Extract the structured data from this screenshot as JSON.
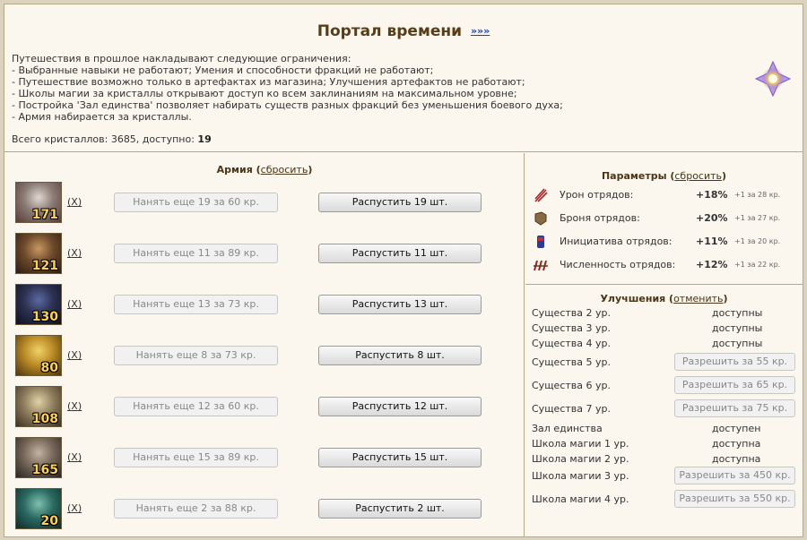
{
  "header": {
    "title": "Портал времени",
    "title_link": "»»»",
    "restrictions": [
      "Путешествия в прошлое накладывают следующие ограничения:",
      "- Выбранные навыки не работают; Умения и способности фракций не работают;",
      "- Путешествие возможно только в артефактах из магазина; Улучшения артефактов не работают;",
      "- Школы магии за кристаллы открывают доступ ко всем заклинаниям на максимальном уровне;",
      "- Постройка 'Зал единства' позволяет набирать существ разных фракций без уменьшения боевого духа;",
      "- Армия набирается за кристаллы."
    ],
    "crystals_label": "Всего кристаллов: 3685, доступно: ",
    "crystals_available": "19",
    "icon": "portal-crystal-icon"
  },
  "army": {
    "title": "Армия",
    "reset_label": "сбросить",
    "units": [
      {
        "count": "171",
        "x_label": "X",
        "hire_label": "Нанять еще 19 за 60 кр.",
        "dismiss_label": "Распустить 19 шт.",
        "portrait": "monk-portrait",
        "colors": [
          "#8a7c74",
          "#e0d6d2",
          "#5b3b3a"
        ]
      },
      {
        "count": "121",
        "x_label": "X",
        "hire_label": "Нанять еще 11 за 89 кр.",
        "dismiss_label": "Распустить 11 шт.",
        "portrait": "centaur-portrait",
        "colors": [
          "#6d4a2b",
          "#c89761",
          "#2d1c10"
        ]
      },
      {
        "count": "130",
        "x_label": "X",
        "hire_label": "Нанять еще 13 за 73 кр.",
        "dismiss_label": "Распустить 13 шт.",
        "portrait": "dark-hood-portrait",
        "colors": [
          "#2d3152",
          "#5a6aa0",
          "#0f1020"
        ]
      },
      {
        "count": "80",
        "x_label": "X",
        "hire_label": "Нанять еще 8 за 73 кр.",
        "dismiss_label": "Распустить 8 шт.",
        "portrait": "golden-helm-portrait",
        "colors": [
          "#b98a25",
          "#f0d26a",
          "#4a3410"
        ]
      },
      {
        "count": "108",
        "x_label": "X",
        "hire_label": "Нанять еще 12 за 60 кр.",
        "dismiss_label": "Распустить 12 шт.",
        "portrait": "veiled-portrait",
        "colors": [
          "#8f7e5e",
          "#e2d2a6",
          "#3d3120"
        ]
      },
      {
        "count": "165",
        "x_label": "X",
        "hire_label": "Нанять еще 15 за 89 кр.",
        "dismiss_label": "Распустить 15 шт.",
        "portrait": "hooded-portrait",
        "colors": [
          "#77685a",
          "#c2b2a0",
          "#2c2520"
        ]
      },
      {
        "count": "20",
        "x_label": "X",
        "hire_label": "Нанять еще 2 за 88 кр.",
        "dismiss_label": "Распустить 2 шт.",
        "portrait": "dragon-portrait",
        "colors": [
          "#2a6a62",
          "#7fc0b0",
          "#102a28"
        ]
      }
    ]
  },
  "params": {
    "title": "Параметры",
    "reset_label": "сбросить",
    "rows": [
      {
        "label": "Урон отрядов:",
        "value": "+18%",
        "note": "+1 за 28 кр.",
        "icon": "damage-icon",
        "color": "#b02020"
      },
      {
        "label": "Броня отрядов:",
        "value": "+20%",
        "note": "+1 за 27 кр.",
        "icon": "armor-icon",
        "color": "#8a6a40"
      },
      {
        "label": "Инициатива отрядов:",
        "value": "+11%",
        "note": "+1 за 20 кр.",
        "icon": "initiative-icon",
        "color": "#2a3a9a"
      },
      {
        "label": "Численность отрядов:",
        "value": "+12%",
        "note": "+1 за 22 кр.",
        "icon": "troop-count-icon",
        "color": "#a02020"
      }
    ]
  },
  "upgrades": {
    "title": "Улучшения",
    "cancel_label": "отменить",
    "rows": [
      {
        "label": "Существа 2 ур.",
        "status": "доступны"
      },
      {
        "label": "Существа 3 ур.",
        "status": "доступны"
      },
      {
        "label": "Существа 4 ур.",
        "status": "доступны"
      },
      {
        "label": "Существа 5 ур.",
        "button": "Разрешить за 55 кр."
      },
      {
        "label": "Существа 6 ур.",
        "button": "Разрешить за 65 кр."
      },
      {
        "label": "Существа 7 ур.",
        "button": "Разрешить за 75 кр."
      },
      {
        "label": "Зал единства",
        "status": "доступен"
      },
      {
        "label": "Школа магии 1 ур.",
        "status": "доступна"
      },
      {
        "label": "Школа магии 2 ур.",
        "status": "доступна"
      },
      {
        "label": "Школа магии 3 ур.",
        "button": "Разрешить за 450 кр."
      },
      {
        "label": "Школа магии 4 ур.",
        "button": "Разрешить за 550 кр."
      }
    ]
  }
}
